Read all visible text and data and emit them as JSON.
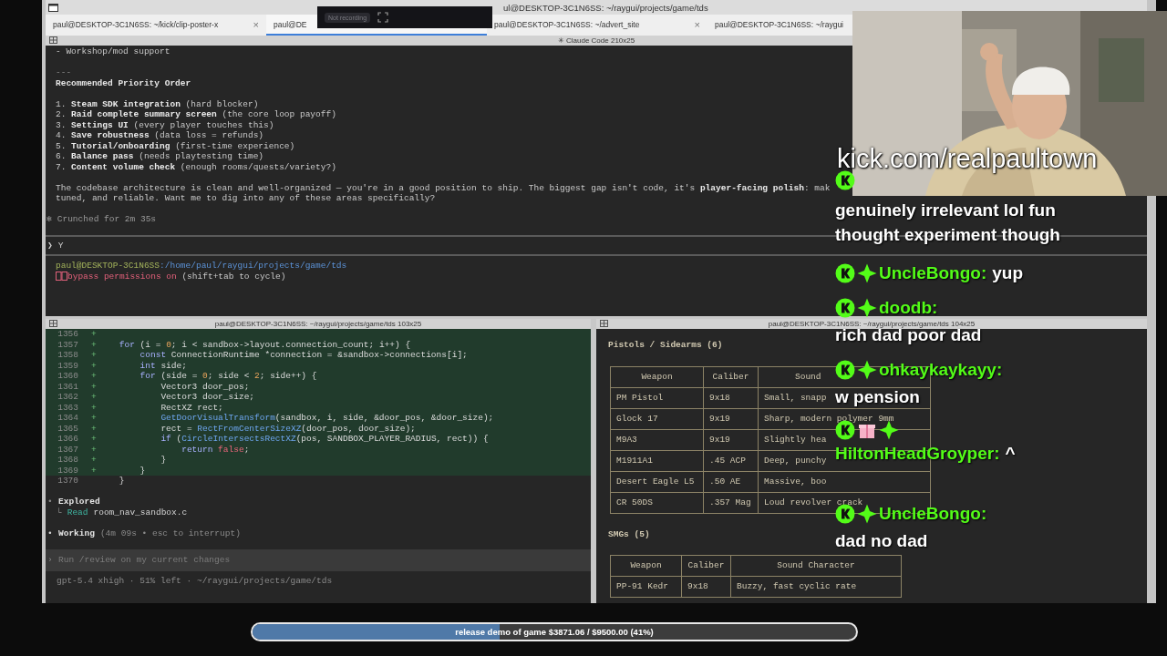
{
  "window": {
    "title": "ul@DESKTOP-3C1N6SS: ~/raygui/projects/game/tds"
  },
  "recorder": {
    "status": "Not recording"
  },
  "tabs": [
    {
      "label": "paul@DESKTOP-3C1N6SS: ~/kick/clip-poster-x",
      "close": "×",
      "selected": false
    },
    {
      "label": "paul@DE",
      "selected": true
    },
    {
      "label": "paul@DESKTOP-3C1N6SS: ~/advert_site",
      "close": "×",
      "selected": false
    },
    {
      "label": "paul@DESKTOP-3C1N6SS: ~/raygui",
      "selected": false
    }
  ],
  "top_pane": {
    "title": "✳ Claude Code 210x25",
    "tail": "- Workshop/mod support",
    "rule": "---",
    "heading": "Recommended Priority Order",
    "items": [
      "1. **Steam SDK integration** (hard blocker)",
      "2. **Raid complete summary screen** (the core loop payoff)",
      "3. **Settings UI** (every player touches this)",
      "4. **Save robustness** (data loss = refunds)",
      "5. **Tutorial/onboarding** (first-time experience)",
      "6. **Balance pass** (needs playtesting time)",
      "7. **Content volume check** (enough rooms/quests/variety?)"
    ],
    "conclusion": [
      "The codebase architecture is clean and well-organized — you're in a good position to ship. The biggest gap isn't code, it's **player-facing polish**: mak",
      "tuned, and reliable. Want me to dig into any of these areas specifically?"
    ],
    "status_symbol": "✻",
    "status": "Crunched for 2m 35s",
    "prompt": {
      "symbol": "❯",
      "text": "Y"
    },
    "shell": {
      "user": "paul@DESKTOP-3C1N6SS",
      "path": ":/home/paul/raygui/projects/game/tds",
      "mode": "bypass permissions on",
      "hint": "(shift+tab to cycle)"
    }
  },
  "left_pane": {
    "title": "paul@DESKTOP-3C1N6SS: ~/raygui/projects/game/tds 103x25",
    "code": [
      {
        "number": "1356",
        "marker": "+",
        "added": true
      },
      {
        "number": "1357",
        "marker": "+",
        "added": true,
        "tokens": [
          {
            "kind": "kw",
            "t": "    for"
          },
          {
            "kind": "plain",
            "t": " (i = "
          },
          {
            "kind": "num",
            "t": "0"
          },
          {
            "kind": "plain",
            "t": "; i < sandbox->layout.connection_count; i++) {"
          }
        ]
      },
      {
        "number": "1358",
        "marker": "+",
        "added": true,
        "tokens": [
          {
            "kind": "kw",
            "t": "        const"
          },
          {
            "kind": "plain",
            "t": " ConnectionRuntime *connection = &sandbox->connections[i];"
          }
        ]
      },
      {
        "number": "1359",
        "marker": "+",
        "added": true,
        "tokens": [
          {
            "kind": "kw",
            "t": "        int"
          },
          {
            "kind": "plain",
            "t": " side;"
          }
        ]
      },
      {
        "number": "1360",
        "marker": "+",
        "added": true,
        "tokens": [
          {
            "kind": "kw",
            "t": "        for"
          },
          {
            "kind": "plain",
            "t": " (side = "
          },
          {
            "kind": "num",
            "t": "0"
          },
          {
            "kind": "plain",
            "t": "; side < "
          },
          {
            "kind": "num",
            "t": "2"
          },
          {
            "kind": "plain",
            "t": "; side++) {"
          }
        ]
      },
      {
        "number": "1361",
        "marker": "+",
        "added": true,
        "tokens": [
          {
            "kind": "plain",
            "t": "            Vector3 door_pos;"
          }
        ]
      },
      {
        "number": "1362",
        "marker": "+",
        "added": true,
        "tokens": [
          {
            "kind": "plain",
            "t": "            Vector3 door_size;"
          }
        ]
      },
      {
        "number": "1363",
        "marker": "+",
        "added": true,
        "tokens": [
          {
            "kind": "plain",
            "t": "            RectXZ rect;"
          }
        ]
      },
      {
        "number": "1364",
        "marker": "+",
        "added": true,
        "tokens": [
          {
            "kind": "fn",
            "t": "            GetDoorVisualTransform"
          },
          {
            "kind": "plain",
            "t": "(sandbox, i, side, &door_pos, &door_size);"
          }
        ]
      },
      {
        "number": "1365",
        "marker": "+",
        "added": true,
        "tokens": [
          {
            "kind": "plain",
            "t": "            rect = "
          },
          {
            "kind": "fn",
            "t": "RectFromCenterSizeXZ"
          },
          {
            "kind": "plain",
            "t": "(door_pos, door_size);"
          }
        ]
      },
      {
        "number": "1366",
        "marker": "+",
        "added": true,
        "tokens": [
          {
            "kind": "kw",
            "t": "            if"
          },
          {
            "kind": "plain",
            "t": " ("
          },
          {
            "kind": "fn",
            "t": "CircleIntersectsRectXZ"
          },
          {
            "kind": "plain",
            "t": "(pos, SANDBOX_PLAYER_RADIUS, rect)) {"
          }
        ]
      },
      {
        "number": "1367",
        "marker": "+",
        "added": true,
        "tokens": [
          {
            "kind": "kw",
            "t": "                return"
          },
          {
            "kind": "bool",
            "t": " false"
          },
          {
            "kind": "plain",
            "t": ";"
          }
        ]
      },
      {
        "number": "1368",
        "marker": "+",
        "added": true,
        "tokens": [
          {
            "kind": "plain",
            "t": "            }"
          }
        ]
      },
      {
        "number": "1369",
        "marker": "+",
        "added": true,
        "tokens": [
          {
            "kind": "plain",
            "t": "        }"
          }
        ]
      },
      {
        "number": "1370",
        "added": false,
        "tokens": [
          {
            "kind": "plain",
            "t": "    }"
          }
        ]
      }
    ],
    "explored": {
      "bullet": "•",
      "title": "Explored",
      "branch": "└",
      "action": "Read",
      "file": "room_nav_sandbox.c"
    },
    "working": {
      "bullet": "•",
      "label": "Working",
      "detail": "(4m 09s • esc to interrupt)"
    },
    "input": {
      "symbol": "›",
      "placeholder": "Run /review on my current changes"
    },
    "footer": "gpt-5.4 xhigh · 51% left · ~/raygui/projects/game/tds"
  },
  "right_pane": {
    "title": "paul@DESKTOP-3C1N6SS: ~/raygui/projects/game/tds 104x25",
    "sections": [
      {
        "heading": "Pistols / Sidearms (6)",
        "columns": [
          "Weapon",
          "Caliber",
          "Sound"
        ],
        "rows": [
          [
            "PM Pistol",
            "9x18",
            "Small, snapp"
          ],
          [
            "Glock 17",
            "9x19",
            "Sharp, modern polymer 9mm"
          ],
          [
            "M9A3",
            "9x19",
            "Slightly hea"
          ],
          [
            "M1911A1",
            ".45 ACP",
            "Deep, punchy"
          ],
          [
            "Desert Eagle L5",
            ".50 AE",
            "Massive, boo"
          ],
          [
            "CR 50DS",
            ".357 Mag",
            "Loud revolver crack"
          ]
        ]
      },
      {
        "heading": "SMGs (5)",
        "columns": [
          "Weapon",
          "Caliber",
          "Sound Character"
        ],
        "rows": [
          [
            "PP-91 Kedr",
            "9x18",
            "Buzzy, fast cyclic rate"
          ]
        ]
      }
    ]
  },
  "stream": {
    "url": "kick.com/realpaultown",
    "chat": [
      {
        "badges": [
          {
            "kind": "kick"
          }
        ],
        "text": "genuinely irrelevant lol fun thought experiment though"
      },
      {
        "badges": [
          {
            "kind": "kick"
          },
          {
            "kind": "sparkle"
          }
        ],
        "user": "UncleBongo:",
        "text": "yup"
      },
      {
        "badges": [
          {
            "kind": "kick"
          },
          {
            "kind": "sparkle"
          }
        ],
        "user": "doodb:",
        "text": "rich dad poor dad"
      },
      {
        "badges": [
          {
            "kind": "kick"
          },
          {
            "kind": "sparkle"
          }
        ],
        "user": "ohkaykaykayy:",
        "text": "w pension"
      },
      {
        "badges": [
          {
            "kind": "kick"
          },
          {
            "kind": "gift"
          },
          {
            "kind": "sparkle"
          }
        ],
        "user": "HiltonHeadGroyper:",
        "text": "^"
      },
      {
        "badges": [
          {
            "kind": "kick"
          },
          {
            "kind": "sparkle"
          }
        ],
        "user": "UncleBongo:",
        "text": "dad no dad"
      }
    ]
  },
  "goal": {
    "label": "release demo of game $3871.06 / $9500.00 (41%)",
    "level": 0.41
  }
}
